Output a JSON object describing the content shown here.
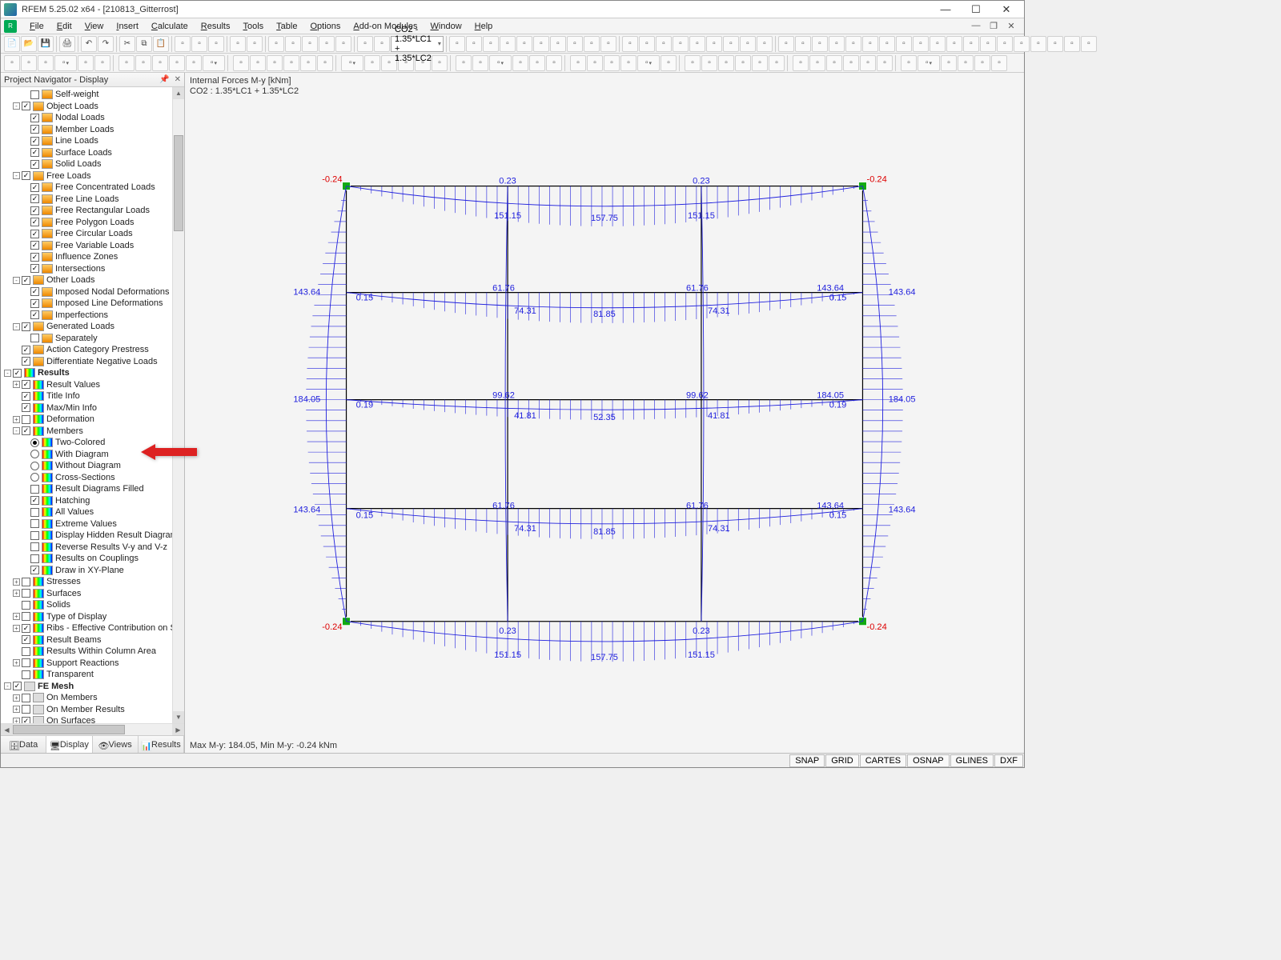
{
  "app": {
    "title": "RFEM 5.25.02 x64 - [210813_Gitterrost]"
  },
  "menu": [
    "File",
    "Edit",
    "View",
    "Insert",
    "Calculate",
    "Results",
    "Tools",
    "Table",
    "Options",
    "Add-on Modules",
    "Window",
    "Help"
  ],
  "combo": {
    "loadcase": "CO2 - 1.35*LC1 + 1.35*LC2"
  },
  "nav": {
    "title": "Project Navigator - Display",
    "tabs": [
      "Data",
      "Display",
      "Views",
      "Results"
    ],
    "active_tab": 1,
    "tree": [
      {
        "d": 2,
        "c": 0,
        "i": "load",
        "l": "Self-weight"
      },
      {
        "d": 1,
        "e": "-",
        "c": 1,
        "i": "load",
        "l": "Object Loads"
      },
      {
        "d": 2,
        "c": 1,
        "i": "load",
        "l": "Nodal Loads"
      },
      {
        "d": 2,
        "c": 1,
        "i": "load",
        "l": "Member Loads"
      },
      {
        "d": 2,
        "c": 1,
        "i": "load",
        "l": "Line Loads"
      },
      {
        "d": 2,
        "c": 1,
        "i": "load",
        "l": "Surface Loads"
      },
      {
        "d": 2,
        "c": 1,
        "i": "load",
        "l": "Solid Loads"
      },
      {
        "d": 1,
        "e": "-",
        "c": 1,
        "i": "load",
        "l": "Free Loads"
      },
      {
        "d": 2,
        "c": 1,
        "i": "load",
        "l": "Free Concentrated Loads"
      },
      {
        "d": 2,
        "c": 1,
        "i": "load",
        "l": "Free Line Loads"
      },
      {
        "d": 2,
        "c": 1,
        "i": "load",
        "l": "Free Rectangular Loads"
      },
      {
        "d": 2,
        "c": 1,
        "i": "load",
        "l": "Free Polygon Loads"
      },
      {
        "d": 2,
        "c": 1,
        "i": "load",
        "l": "Free Circular Loads"
      },
      {
        "d": 2,
        "c": 1,
        "i": "load",
        "l": "Free Variable Loads"
      },
      {
        "d": 2,
        "c": 1,
        "i": "load",
        "l": "Influence Zones"
      },
      {
        "d": 2,
        "c": 1,
        "i": "load",
        "l": "Intersections"
      },
      {
        "d": 1,
        "e": "-",
        "c": 1,
        "i": "load",
        "l": "Other Loads"
      },
      {
        "d": 2,
        "c": 1,
        "i": "load",
        "l": "Imposed Nodal Deformations"
      },
      {
        "d": 2,
        "c": 1,
        "i": "load",
        "l": "Imposed Line Deformations"
      },
      {
        "d": 2,
        "c": 1,
        "i": "load",
        "l": "Imperfections"
      },
      {
        "d": 1,
        "e": "-",
        "c": 1,
        "i": "load",
        "l": "Generated Loads"
      },
      {
        "d": 2,
        "c": 0,
        "i": "load",
        "l": "Separately"
      },
      {
        "d": 1,
        "c": 1,
        "i": "load",
        "l": "Action Category Prestress"
      },
      {
        "d": 1,
        "c": 1,
        "i": "load",
        "l": "Differentiate Negative Loads"
      },
      {
        "d": 0,
        "e": "-",
        "c": 1,
        "i": "res",
        "l": "Results",
        "b": 1
      },
      {
        "d": 1,
        "e": "+",
        "c": 1,
        "i": "res",
        "l": "Result Values"
      },
      {
        "d": 1,
        "c": 1,
        "i": "res",
        "l": "Title Info"
      },
      {
        "d": 1,
        "c": 1,
        "i": "res",
        "l": "Max/Min Info"
      },
      {
        "d": 1,
        "e": "+",
        "c": 0,
        "i": "res",
        "l": "Deformation"
      },
      {
        "d": 1,
        "e": "-",
        "c": 1,
        "i": "res",
        "l": "Members"
      },
      {
        "d": 2,
        "r": 1,
        "i": "res",
        "l": "Two-Colored"
      },
      {
        "d": 2,
        "r": 0,
        "i": "res",
        "l": "With Diagram"
      },
      {
        "d": 2,
        "r": 0,
        "i": "res",
        "l": "Without Diagram"
      },
      {
        "d": 2,
        "r": 0,
        "i": "res",
        "l": "Cross-Sections"
      },
      {
        "d": 2,
        "c": 0,
        "i": "res",
        "l": "Result Diagrams Filled"
      },
      {
        "d": 2,
        "c": 1,
        "i": "res",
        "l": "Hatching"
      },
      {
        "d": 2,
        "c": 0,
        "i": "res",
        "l": "All Values"
      },
      {
        "d": 2,
        "c": 0,
        "i": "res",
        "l": "Extreme Values"
      },
      {
        "d": 2,
        "c": 0,
        "i": "res",
        "l": "Display Hidden Result Diagram"
      },
      {
        "d": 2,
        "c": 0,
        "i": "res",
        "l": "Reverse Results V-y and V-z"
      },
      {
        "d": 2,
        "c": 0,
        "i": "res",
        "l": "Results on Couplings"
      },
      {
        "d": 2,
        "c": 1,
        "i": "res",
        "l": "Draw in XY-Plane"
      },
      {
        "d": 1,
        "e": "+",
        "c": 0,
        "i": "res",
        "l": "Stresses"
      },
      {
        "d": 1,
        "e": "+",
        "c": 0,
        "i": "res",
        "l": "Surfaces"
      },
      {
        "d": 1,
        "c": 0,
        "i": "res",
        "l": "Solids"
      },
      {
        "d": 1,
        "e": "+",
        "c": 0,
        "i": "res",
        "l": "Type of Display"
      },
      {
        "d": 1,
        "e": "+",
        "c": 1,
        "i": "res",
        "l": "Ribs - Effective Contribution on Su"
      },
      {
        "d": 1,
        "c": 1,
        "i": "res",
        "l": "Result Beams"
      },
      {
        "d": 1,
        "c": 0,
        "i": "res",
        "l": "Results Within Column Area"
      },
      {
        "d": 1,
        "e": "+",
        "c": 0,
        "i": "res",
        "l": "Support Reactions"
      },
      {
        "d": 1,
        "c": 0,
        "i": "res",
        "l": "Transparent"
      },
      {
        "d": 0,
        "e": "-",
        "c": 1,
        "i": "grid",
        "l": "FE Mesh",
        "b": 1
      },
      {
        "d": 1,
        "e": "+",
        "c": 0,
        "i": "grid",
        "l": "On Members"
      },
      {
        "d": 1,
        "e": "+",
        "c": 0,
        "i": "grid",
        "l": "On Member Results"
      },
      {
        "d": 1,
        "e": "+",
        "c": 1,
        "i": "grid",
        "l": "On Surfaces"
      },
      {
        "d": 1,
        "e": "+",
        "c": 0,
        "i": "grid",
        "l": "On Surface Results"
      }
    ]
  },
  "viewport": {
    "title_l1": "Internal Forces M-y [kNm]",
    "title_l2": "CO2 : 1.35*LC1 + 1.35*LC2",
    "footer": "Max M-y: 184.05, Min M-y: -0.24 kNm",
    "labels": {
      "neg": "-0.24",
      "top_mid": "0.23",
      "r1_end": "151.15",
      "r1_mid": "157.75",
      "r2_left": "143.64",
      "r2_s": "0.15",
      "r2_m1": "61.76",
      "r2_m2": "74.31",
      "r2_mid": "81.85",
      "r2_r": "143.64",
      "r3_left": "184.05",
      "r3_s": "0.19",
      "r3_m1": "99.62",
      "r3_m2": "41.81",
      "r3_mid": "52.35",
      "r3_r": "184.05"
    }
  },
  "status": [
    "SNAP",
    "GRID",
    "CARTES",
    "OSNAP",
    "GLINES",
    "DXF"
  ],
  "icons": {
    "new": "📄",
    "open": "📂",
    "save": "💾",
    "print": "🖨",
    "undo": "↶",
    "redo": "↷",
    "cut": "✂",
    "copy": "⧉",
    "paste": "📋",
    "zoom": "🔍",
    "pan": "✋",
    "rot": "🔄"
  }
}
